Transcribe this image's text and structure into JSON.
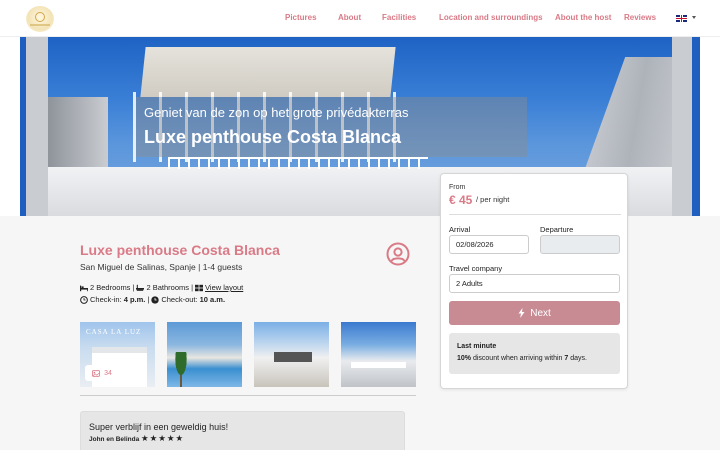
{
  "nav": {
    "items": [
      {
        "label": "Pictures"
      },
      {
        "label": "About"
      },
      {
        "label": "Facilities"
      },
      {
        "label": "Location and surroundings"
      },
      {
        "label": "About the host"
      },
      {
        "label": "Reviews"
      }
    ],
    "language": "English (UK flag)"
  },
  "hero": {
    "subtitle": "Geniet van de zon op het grote privédakterras",
    "title": "Luxe penthouse Costa Blanca"
  },
  "property": {
    "title": "Luxe penthouse Costa Blanca",
    "location": "San Miguel de Salinas, Spanje | 1-4 guests",
    "bedrooms": "2 Bedrooms |",
    "bathrooms": "2 Bathrooms |",
    "layout_link": "View layout",
    "checkin_label": "Check-in:",
    "checkin_time": "4 p.m.",
    "separator": "|",
    "checkout_label": "Check-out:",
    "checkout_time": "10 a.m."
  },
  "gallery": {
    "thumb1_caption": "CASA LA LUZ",
    "photo_count": "34"
  },
  "review": {
    "text": "Super verblijf in een geweldig huis!",
    "author": "John en Belinda",
    "stars": [
      "★",
      "★",
      "★",
      "★",
      "★"
    ]
  },
  "booking": {
    "from_label": "From",
    "price": "€ 45",
    "per_night": "/ per night",
    "arrival_label": "Arrival",
    "arrival_value": "02/08/2026",
    "departure_label": "Departure",
    "departure_value": "",
    "company_label": "Travel company",
    "company_value": "2 Adults",
    "next_label": "Next",
    "last_minute_title": "Last minute",
    "last_minute_pct": "10%",
    "last_minute_text1": " discount when arriving within ",
    "last_minute_days": "7",
    "last_minute_text2": " days."
  },
  "colors": {
    "accent": "#d97a86",
    "button": "#c88b94"
  }
}
